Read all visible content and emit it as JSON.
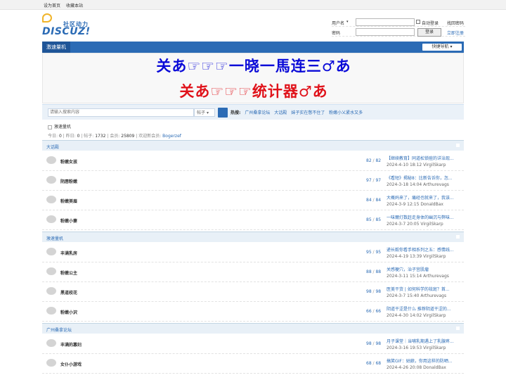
{
  "topbar": {
    "set_home": "设为首页",
    "favorite": "收藏本站"
  },
  "logo": {
    "slogan": "社区动力",
    "name": "DISCUZ!"
  },
  "login": {
    "username_label": "用户名",
    "password_label": "密码",
    "auto_login": "自动登录",
    "forgot": "找回密码",
    "login_button": "登录",
    "register": "立即注册"
  },
  "nav": {
    "current": "激速量机",
    "quick_nav": "快捷导航"
  },
  "banner": {
    "line1": "关あ☞☞☞一晓一馬连三♂あ",
    "line2": "关あ☞☞☞统计器♂あ"
  },
  "search": {
    "placeholder": "请输入搜索内容",
    "type": "帖子",
    "hot_label": "热搜:",
    "hot": [
      "广州桑拿论坛",
      "大话殿",
      "妹子实在憋不住了",
      "粉嫩小乂紧水又多"
    ]
  },
  "breadcrumb": "激速量机",
  "stats": {
    "today_label": "今日:",
    "today": "0",
    "yesterday_label": "昨日:",
    "yesterday": "0",
    "posts_label": "帖子:",
    "posts": "1732",
    "members_label": "会员:",
    "members": "25809",
    "newest_label": "欢迎新会员:",
    "newest": "Bogerzef"
  },
  "sections": [
    {
      "title": "大话殿",
      "forums": [
        {
          "name": "粉嫩女孩",
          "threads": "82",
          "posts": "82",
          "last": "【继续教育】同道松锁痘的详治现...",
          "date": "2024-4-10 18:12",
          "user": "VirgilSkarp"
        },
        {
          "name": "阴唇粉嫩",
          "threads": "97",
          "posts": "97",
          "last": "《看短》揭秘8：比新告诉你，怎...",
          "date": "2024-3-18 14:04",
          "user": "Arthurevags"
        },
        {
          "name": "粉嫩美眉",
          "threads": "84",
          "posts": "84",
          "last": "大概妈来了，痛经也就来了，我该...",
          "date": "2024-3-9 12:15",
          "user": "DonaldBax"
        },
        {
          "name": "粉嫩小妻",
          "threads": "85",
          "posts": "85",
          "last": "一味爾灯数赶走身体的幽沉与弊味...",
          "date": "2024-3-7 20:05",
          "user": "VirgilSkarp"
        }
      ]
    },
    {
      "title": "激速量机",
      "forums": [
        {
          "name": "丰满乳房",
          "threads": "95",
          "posts": "95",
          "last": "递长毅你看手相系列之五：感情线...",
          "date": "2024-4-19 13:39",
          "user": "VirgilSkarp"
        },
        {
          "name": "粉嫩公主",
          "threads": "88",
          "posts": "88",
          "last": "关感梗穴，治子宫肌瘤",
          "date": "2024-3-11 15:14",
          "user": "Arthurevags"
        },
        {
          "name": "黑道校花",
          "threads": "98",
          "posts": "98",
          "last": "医美干货 | 如何科学的祛斑？首...",
          "date": "2024-3-7 15:40",
          "user": "Arthurevags"
        },
        {
          "name": "粉嫩小沢",
          "threads": "66",
          "posts": "66",
          "last": "阴道干涩是什么 推荐阴道干涩的...",
          "date": "2024-4-30 14:02",
          "user": "VirgilSkarp"
        }
      ]
    },
    {
      "title": "广州桑拿论坛",
      "forums": [
        {
          "name": "丰满的寡妇",
          "threads": "98",
          "posts": "98",
          "last": "月子课堂｜当哺乳期遇上了乳腺疼...",
          "date": "2024-3-16 19:53",
          "user": "VirgilSkarp"
        },
        {
          "name": "女仆小游戏",
          "threads": "68",
          "posts": "68",
          "last": "搞笑GIF：姑娘，你用这样的防晒...",
          "date": "2024-4-26 20:08",
          "user": "DonaldBax"
        }
      ]
    }
  ]
}
